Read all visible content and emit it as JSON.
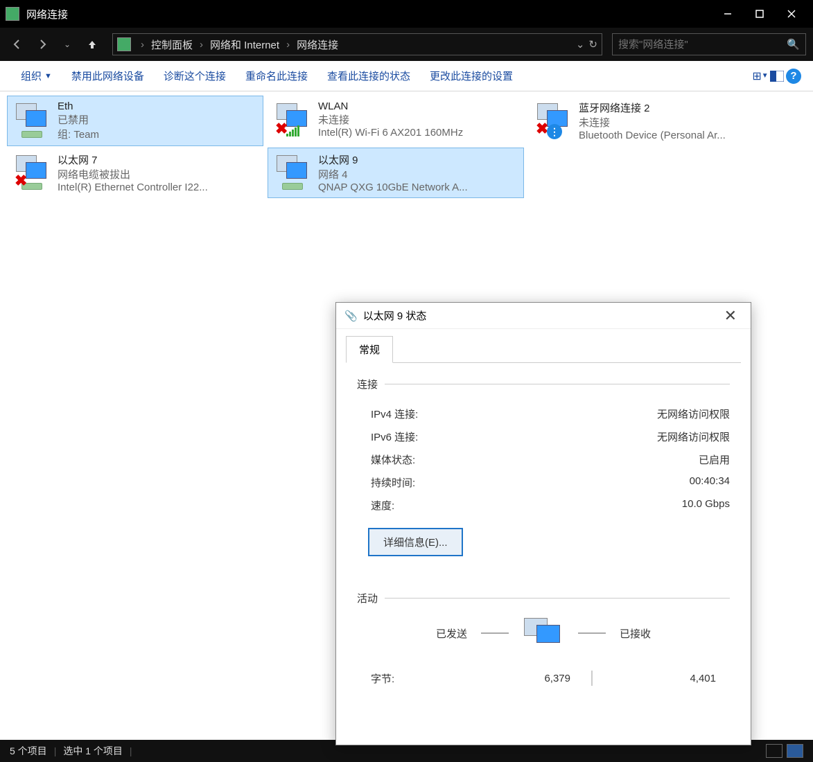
{
  "window": {
    "title": "网络连接"
  },
  "breadcrumb": {
    "items": [
      "控制面板",
      "网络和 Internet",
      "网络连接"
    ]
  },
  "search": {
    "placeholder": "搜索\"网络连接\""
  },
  "toolbar": {
    "organize": "组织",
    "disable": "禁用此网络设备",
    "diagnose": "诊断这个连接",
    "rename": "重命名此连接",
    "viewstatus": "查看此连接的状态",
    "changeset": "更改此连接的设置"
  },
  "connections": [
    {
      "name": "Eth",
      "status": "已禁用",
      "device": "组: Team",
      "selected": true,
      "overlay": "plug"
    },
    {
      "name": "WLAN",
      "status": "未连接",
      "device": "Intel(R) Wi-Fi 6 AX201 160MHz",
      "overlay": "wifi-x"
    },
    {
      "name": "蓝牙网络连接 2",
      "status": "未连接",
      "device": "Bluetooth Device (Personal Ar...",
      "overlay": "bt-x"
    },
    {
      "name": "以太网 7",
      "status": "网络电缆被拔出",
      "device": "Intel(R) Ethernet Controller I22...",
      "overlay": "plug-x"
    },
    {
      "name": "以太网 9",
      "status": "网络 4",
      "device": "QNAP QXG 10GbE Network A...",
      "selected": true,
      "overlay": "plug"
    }
  ],
  "statusbar": {
    "count": "5 个项目",
    "selected": "选中 1 个项目"
  },
  "dialog": {
    "title": "以太网 9 状态",
    "tab": "常规",
    "conn_section": "连接",
    "rows": {
      "ipv4_label": "IPv4 连接:",
      "ipv4_value": "无网络访问权限",
      "ipv6_label": "IPv6 连接:",
      "ipv6_value": "无网络访问权限",
      "media_label": "媒体状态:",
      "media_value": "已启用",
      "duration_label": "持续时间:",
      "duration_value": "00:40:34",
      "speed_label": "速度:",
      "speed_value": "10.0 Gbps"
    },
    "details_btn": "详细信息(E)...",
    "activity_section": "活动",
    "sent_label": "已发送",
    "recv_label": "已接收",
    "bytes_label": "字节:",
    "bytes_sent": "6,379",
    "bytes_recv": "4,401"
  }
}
